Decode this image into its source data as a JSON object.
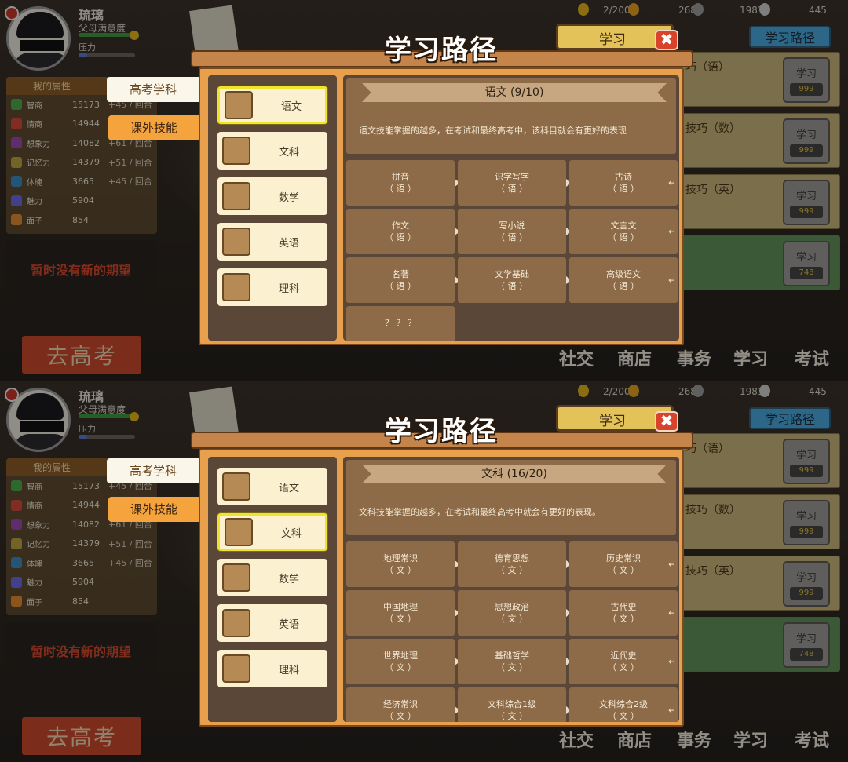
{
  "player": {
    "name": "琉璃",
    "satisfaction_label": "父母满意度",
    "pressure_label": "压力"
  },
  "resources": {
    "energy": "2/200",
    "bulb": "268",
    "clock": "1981",
    "phone": "445"
  },
  "attributes": {
    "title": "我的属性",
    "rows": [
      {
        "name": "智商",
        "value": "15173",
        "gain": "+45 / 回合"
      },
      {
        "name": "情商",
        "value": "14944",
        "gain": "+45 / 回合"
      },
      {
        "name": "想象力",
        "value": "14082",
        "gain": "+61 / 回合"
      },
      {
        "name": "记忆力",
        "value": "14379",
        "gain": "+51 / 回合"
      },
      {
        "name": "体魄",
        "value": "3665",
        "gain": "+45 / 回合"
      },
      {
        "name": "魅力",
        "value": "5904",
        "gain": ""
      },
      {
        "name": "面子",
        "value": "854",
        "gain": ""
      }
    ]
  },
  "no_wish": "暂时没有新的期望",
  "go_exam": "去高考",
  "side_tabs": {
    "gaokao": "高考学科",
    "extra": "课外技能"
  },
  "right": {
    "tab_study": "学习",
    "tab_path": "学习路径",
    "rows": [
      {
        "title": "巧（语）",
        "btn": "学习",
        "cost": "999"
      },
      {
        "title": "技巧（数）",
        "btn": "学习",
        "cost": "999"
      },
      {
        "title": "技巧（英）",
        "btn": "学习",
        "cost": "999"
      },
      {
        "title": "",
        "btn": "学习",
        "cost": "748"
      }
    ],
    "nav": [
      "社交",
      "商店",
      "事务",
      "学习",
      "考试"
    ]
  },
  "modal": {
    "title": "学习路径",
    "close": "✖"
  },
  "subjects": [
    "语文",
    "文科",
    "数学",
    "英语",
    "理科"
  ],
  "screens": [
    {
      "selected": 0,
      "header": "语文 (9/10)",
      "desc": "语文技能掌握的越多，在考试和最终高考中，该科目就会有更好的表现",
      "skills": [
        [
          "拼音",
          "（ 语 ）"
        ],
        [
          "识字写字",
          "（ 语 ）"
        ],
        [
          "古诗",
          "（ 语 ）"
        ],
        [
          "作文",
          "（ 语 ）"
        ],
        [
          "写小说",
          "（ 语 ）"
        ],
        [
          "文言文",
          "（ 语 ）"
        ],
        [
          "名著",
          "（ 语 ）"
        ],
        [
          "文学基础",
          "（ 语 ）"
        ],
        [
          "高级语文",
          "（ 语 ）"
        ],
        [
          "？ ？ ？",
          ""
        ]
      ]
    },
    {
      "selected": 1,
      "header": "文科 (16/20)",
      "desc": "文科技能掌握的越多，在考试和最终高考中就会有更好的表现。",
      "skills": [
        [
          "地理常识",
          "（ 文 ）"
        ],
        [
          "德育思想",
          "（ 文 ）"
        ],
        [
          "历史常识",
          "（ 文 ）"
        ],
        [
          "中国地理",
          "（ 文 ）"
        ],
        [
          "思想政治",
          "（ 文 ）"
        ],
        [
          "古代史",
          "（ 文 ）"
        ],
        [
          "世界地理",
          "（ 文 ）"
        ],
        [
          "基础哲学",
          "（ 文 ）"
        ],
        [
          "近代史",
          "（ 文 ）"
        ],
        [
          "经济常识",
          "（ 文 ）"
        ],
        [
          "文科综合1级",
          "（ 文 ）"
        ],
        [
          "文科综合2级",
          "（ 文 ）"
        ]
      ]
    }
  ],
  "colors": {
    "accent": "#e9a04d",
    "selected_border": "#f0e32c",
    "close": "#d9432b"
  }
}
